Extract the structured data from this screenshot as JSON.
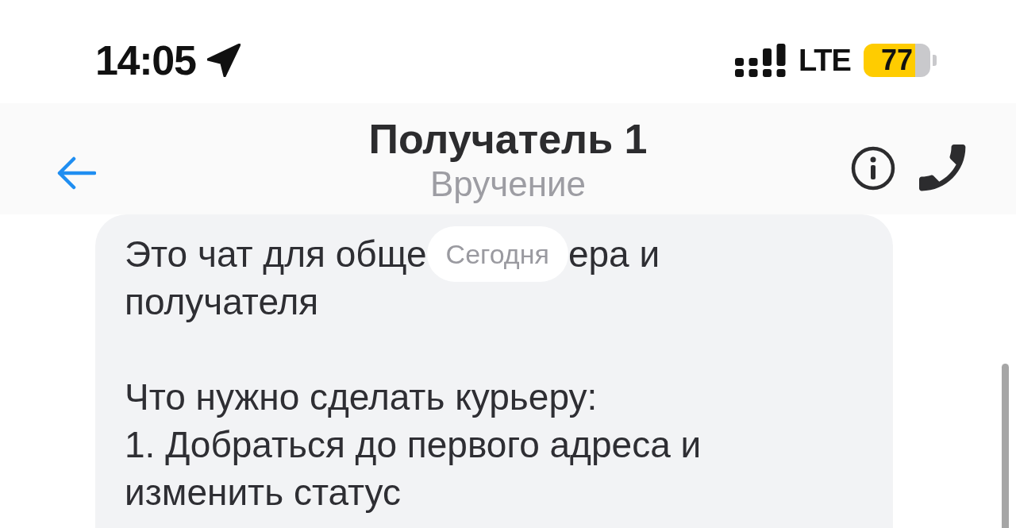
{
  "status_bar": {
    "time": "14:05",
    "network": "LTE",
    "battery": "77"
  },
  "header": {
    "title": "Получатель 1",
    "subtitle": "Вручение"
  },
  "chat": {
    "date_chip": "Сегодня",
    "message": {
      "text_before_chip": "Это чат для обще",
      "text_after_chip": "ера и",
      "next_line": "получателя",
      "paragraphs": [
        "Что нужно сделать курьеру:",
        "1. Добраться до первого адреса и изменить статус"
      ]
    }
  }
}
